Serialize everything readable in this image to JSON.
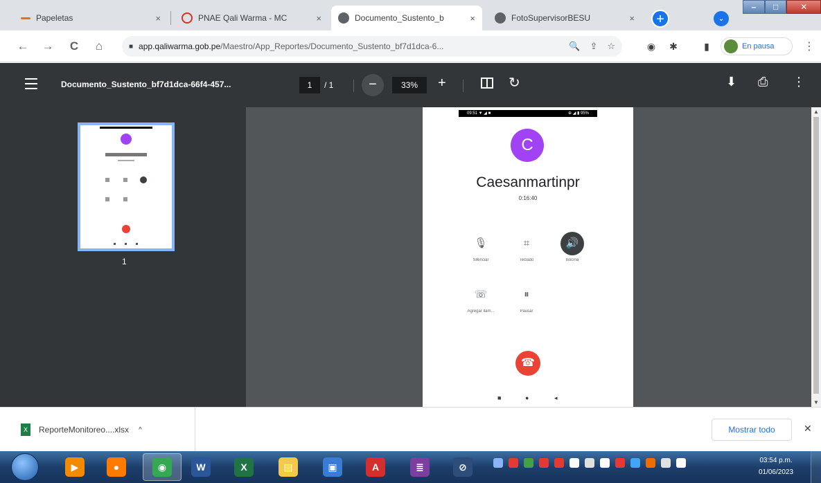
{
  "browser": {
    "tabs": [
      {
        "title": "Papeletas",
        "close": "×",
        "icon": "dash-favicon",
        "color": "#e8710a"
      },
      {
        "title": "PNAE Qali Warma - MC",
        "close": "×",
        "icon": "qw-favicon",
        "color": "#d93025"
      },
      {
        "title": "Documento_Sustento_b",
        "close": "×",
        "icon": "globe-favicon",
        "color": "#5f6368"
      },
      {
        "title": "FotoSupervisorBESU",
        "close": "×",
        "icon": "globe-favicon",
        "color": "#5f6368"
      }
    ],
    "new_tab": "+",
    "profile_menu": "⌄",
    "window_controls": {
      "minimize": "–",
      "maximize": "□",
      "close": "✕"
    },
    "nav": {
      "back": "←",
      "forward": "→",
      "reload": "C",
      "home": "⌂"
    },
    "url_host": "app.qaliwarma.gob.pe",
    "url_path": "/Maestro/App_Reportes/Documento_Sustento_bf7d1dca-6...",
    "omni_icons": {
      "zoom": "🔍",
      "share": "⇪",
      "star": "☆"
    },
    "toolbar_icons": {
      "extensions_1": "◉",
      "extensions_2": "✱",
      "sidepanel": "▮"
    },
    "pause_label": "En pausa",
    "menu": "⋮"
  },
  "pdf": {
    "filename": "Documento_Sustento_bf7d1dca-66f4-457...",
    "page_current": "1",
    "page_total": "/ 1",
    "zoom": "33%",
    "zoom_out": "−",
    "zoom_in": "+",
    "rotate": "↻",
    "download": "⬇",
    "print": "⎙",
    "more": "⋮",
    "thumb_page_number": "1"
  },
  "call_screen": {
    "status_left": "09:51 ▼ ◢ ■",
    "status_right": "⊕ ◢ ▮ 95%",
    "avatar_letter": "C",
    "contact_name": "Caesanmartinpr",
    "duration": "0:16:40",
    "controls": [
      {
        "label": "Silenciar",
        "icon": "🎙",
        "dark": false
      },
      {
        "label": "Teclado",
        "icon": "⌗",
        "dark": false
      },
      {
        "label": "Bocina",
        "icon": "🔊",
        "dark": true
      },
      {
        "label": "Agregar llam...",
        "icon": "☏",
        "dark": false
      },
      {
        "label": "Pausar",
        "icon": "⏸",
        "dark": false
      }
    ],
    "end_call": "☎",
    "nav_dots": [
      "■",
      "●",
      "◂"
    ]
  },
  "downloads": {
    "file_label": "ReporteMonitoreo....xlsx",
    "file_icon_letter": "X",
    "caret": "^",
    "show_all": "Mostrar todo",
    "close": "✕"
  },
  "taskbar": {
    "apps": [
      {
        "name": "media-player",
        "glyph": "▶",
        "color": "#f28b00"
      },
      {
        "name": "firefox",
        "glyph": "●",
        "color": "#ff7a00"
      },
      {
        "name": "chrome",
        "glyph": "◉",
        "color": "#34a853"
      },
      {
        "name": "word",
        "glyph": "W",
        "color": "#2b579a"
      },
      {
        "name": "excel",
        "glyph": "X",
        "color": "#217346"
      },
      {
        "name": "explorer",
        "glyph": "▤",
        "color": "#f2c94c"
      },
      {
        "name": "remote",
        "glyph": "▣",
        "color": "#3a7bd5"
      },
      {
        "name": "acrobat",
        "glyph": "A",
        "color": "#d32f2f"
      },
      {
        "name": "winrar",
        "glyph": "≣",
        "color": "#7b3fa0"
      },
      {
        "name": "safari",
        "glyph": "⊘",
        "color": "#2f4d7a"
      }
    ],
    "tray_colors": [
      "#8ab4f8",
      "#e53935",
      "#43a047",
      "#e53935",
      "#e53935",
      "#fafafa",
      "#e0e0e0",
      "#fafafa",
      "#e53935",
      "#42a5f5",
      "#ef6c00",
      "#e0e0e0",
      "#fafafa"
    ],
    "time": "03:54 p.m.",
    "date": "01/06/2023"
  }
}
